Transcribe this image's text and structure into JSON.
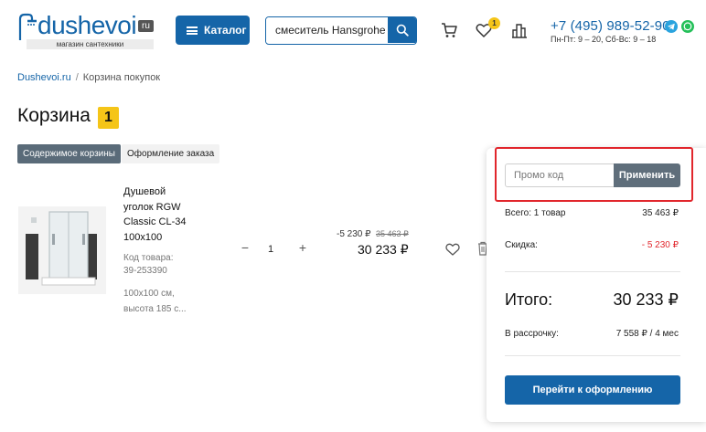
{
  "header": {
    "logo_text": "dushevoi",
    "logo_ru": "ru",
    "logo_tagline": "магазин сантехники",
    "catalog_label": "Каталог",
    "search_value": "смеситель Hansgrohe",
    "favorites_count": "1",
    "phone": "+7 (495) 989-52-90",
    "hours": "Пн-Пт: 9 – 20, Сб-Вс: 9 – 18",
    "icons": [
      "cart-icon",
      "heart-icon",
      "compare-icon",
      "telegram-icon",
      "whatsapp-icon"
    ],
    "colors": {
      "brand_blue": "#1565a8",
      "badge_yellow": "#f5c518",
      "whatsapp_green": "#25c05a"
    }
  },
  "breadcrumb": {
    "home": "Dushevoi.ru",
    "separator": "/",
    "current": "Корзина покупок"
  },
  "page": {
    "title": "Корзина",
    "count": "1"
  },
  "tabs": [
    {
      "label": "Содержимое корзины",
      "active": true
    },
    {
      "label": "Оформление заказа",
      "active": false
    }
  ],
  "item": {
    "name": "Душевой уголок RGW Classic CL-34 100x100",
    "code_label": "Код товара:",
    "code": "39-253390",
    "dims": "100x100 см, высота 185 с...",
    "qty_minus": "−",
    "qty": "1",
    "qty_plus": "+",
    "discount": "-5 230 ₽",
    "old_price": "35 463 ₽",
    "price": "30 233 ₽"
  },
  "summary": {
    "promo_placeholder": "Промо код",
    "promo_button": "Применить",
    "total_items_label": "Всего: 1 товар",
    "total_items_value": "35 463 ₽",
    "discount_label": "Скидка:",
    "discount_value": "- 5 230 ₽",
    "grand_label": "Итого:",
    "grand_value": "30 233 ₽",
    "installment_label": "В рассрочку:",
    "installment_value": "7 558 ₽ / 4 мес",
    "checkout_button": "Перейти к оформлению",
    "colors": {
      "discount_red": "#e1262c",
      "highlight_red": "#e1262c"
    }
  }
}
